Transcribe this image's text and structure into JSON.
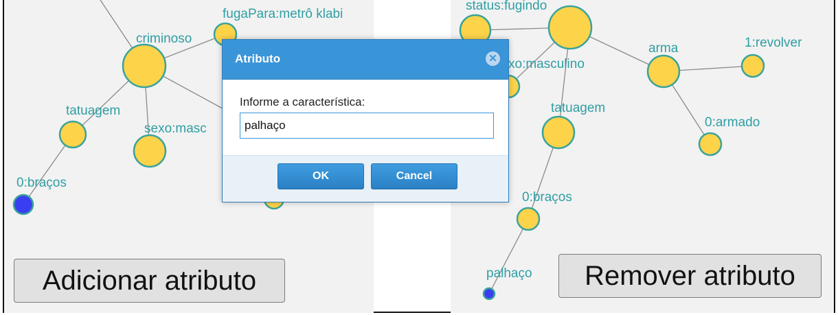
{
  "left_panel": {
    "labels": {
      "fuga": "fugaPara:metrô klabi",
      "criminoso": "criminoso",
      "tatuagem": "tatuagem",
      "sexo": "sexo:masc",
      "bracos": "0:braços"
    },
    "add_button_label": "Adicionar atributo"
  },
  "right_panel": {
    "labels": {
      "status": "status:fugindo",
      "sexo": "xo:masculino",
      "arma": "arma",
      "revolver": "1:revolver",
      "tatuagem": "tatuagem",
      "armado": "0:armado",
      "bracos": "0:braços",
      "palhaco": "palhaço"
    },
    "remove_button_label": "Remover atributo"
  },
  "dialog": {
    "title": "Atributo",
    "close_glyph": "✕",
    "prompt": "Informe a característica:",
    "input_value": "palhaço",
    "ok_label": "OK",
    "cancel_label": "Cancel"
  },
  "colors": {
    "attribute_node_fill": "#fdd34a",
    "node_stroke": "#3aa39b",
    "value_node_fill": "#3a3ef2",
    "label_color": "#2f9ea3",
    "dialog_header": "#3a95d8"
  }
}
